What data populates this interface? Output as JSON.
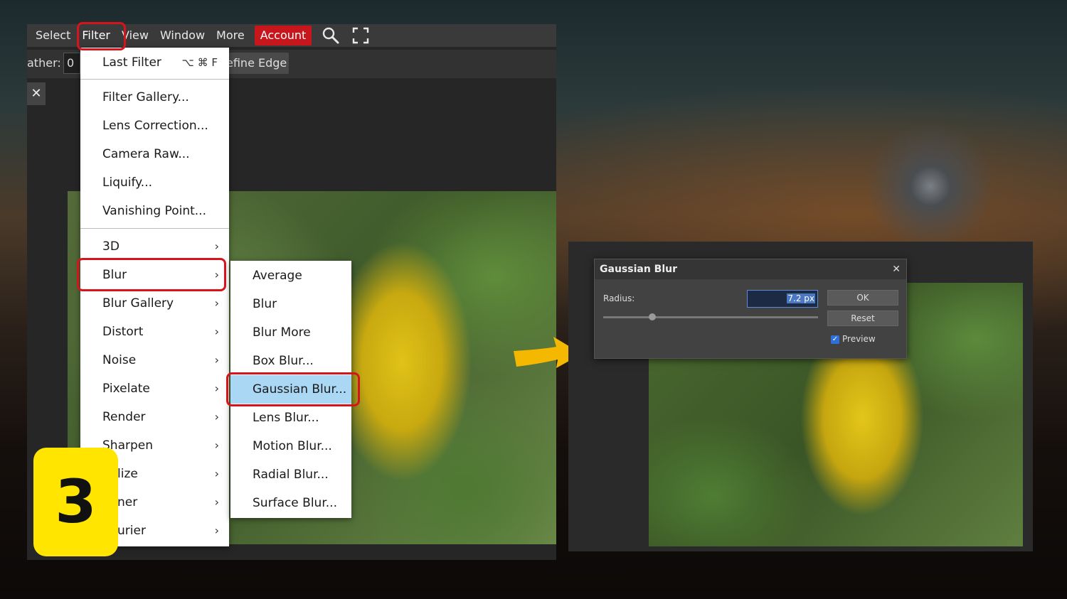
{
  "menubar": {
    "items": [
      "Select",
      "Filter",
      "View",
      "Window",
      "More"
    ],
    "account_label": "Account"
  },
  "options_bar": {
    "feather_label": "ather:",
    "feather_value": "0 p",
    "refine_edge_label": "efine Edge"
  },
  "doc": {
    "close_glyph": "✕"
  },
  "filter_menu": {
    "last_filter": {
      "label": "Last Filter",
      "shortcut": "⌥ ⌘ F"
    },
    "group1": [
      "Filter Gallery...",
      "Lens Correction...",
      "Camera Raw...",
      "Liquify...",
      "Vanishing Point..."
    ],
    "group2": [
      "3D",
      "Blur",
      "Blur Gallery",
      "Distort",
      "Noise",
      "Pixelate",
      "Render",
      "Sharpen",
      "lize",
      "ner",
      "urier"
    ]
  },
  "blur_submenu": {
    "items": [
      "Average",
      "Blur",
      "Blur More",
      "Box Blur...",
      "Gaussian Blur...",
      "Lens Blur...",
      "Motion Blur...",
      "Radial Blur...",
      "Surface Blur..."
    ],
    "selected": "Gaussian Blur..."
  },
  "step_badge": {
    "number": "3"
  },
  "gaussian_dialog": {
    "title": "Gaussian Blur",
    "close_glyph": "✕",
    "radius_label": "Radius:",
    "radius_value": "7.2 px",
    "slider_fraction": 0.23,
    "ok_label": "OK",
    "reset_label": "Reset",
    "preview_label": "Preview",
    "preview_checked": true
  },
  "colors": {
    "highlight": "#d6141c",
    "account": "#c8161d",
    "selected_item": "#a9d7f4",
    "badge": "#ffe500",
    "arrow": "#f5b800"
  }
}
